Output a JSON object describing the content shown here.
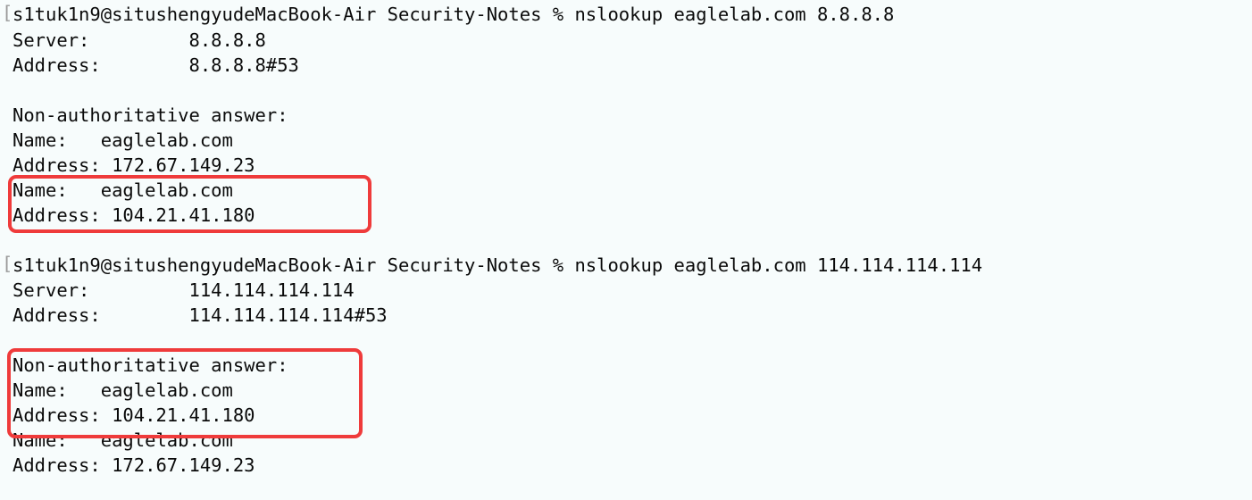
{
  "terminal": {
    "prompt_bracket": "[",
    "lines": [
      "s1tuk1n9@situshengyudeMacBook-Air Security-Notes % nslookup eaglelab.com 8.8.8.8",
      "Server:         8.8.8.8",
      "Address:        8.8.8.8#53",
      "",
      "Non-authoritative answer:",
      "Name:   eaglelab.com",
      "Address: 172.67.149.23",
      "Name:   eaglelab.com",
      "Address: 104.21.41.180",
      "",
      "s1tuk1n9@situshengyudeMacBook-Air Security-Notes % nslookup eaglelab.com 114.114.114.114",
      "Server:         114.114.114.114",
      "Address:        114.114.114.114#53",
      "",
      "Non-authoritative answer:",
      "Name:   eaglelab.com",
      "Address: 104.21.41.180",
      "Name:   eaglelab.com",
      "Address: 172.67.149.23"
    ]
  },
  "colors": {
    "background": "#f7fcfc",
    "text": "#0a0a0a",
    "highlight": "#ef3b3b"
  }
}
